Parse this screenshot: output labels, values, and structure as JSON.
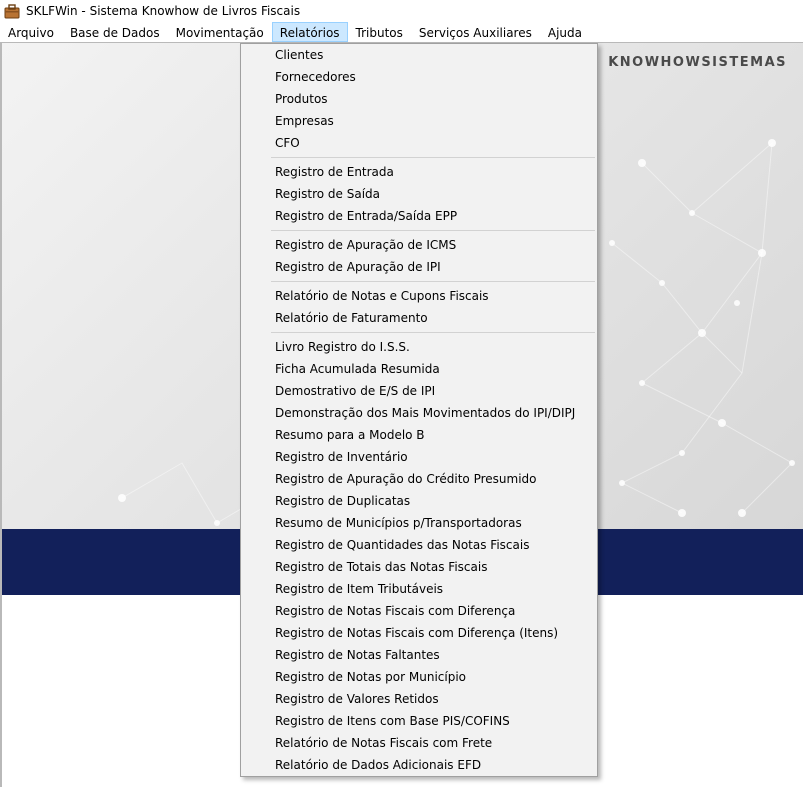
{
  "window": {
    "title": "SKLFWin - Sistema Knowhow de Livros Fiscais",
    "icon": "briefcase-icon"
  },
  "menubar": {
    "items": [
      "Arquivo",
      "Base de Dados",
      "Movimentação",
      "Relatórios",
      "Tributos",
      "Serviços Auxiliares",
      "Ajuda"
    ],
    "active": "Relatórios"
  },
  "banner": {
    "brand": "KNOWHOWSISTEMAS"
  },
  "colors": {
    "menu_highlight": "#cce8ff",
    "navy_band": "#12205a",
    "menu_background": "#f2f2f2"
  },
  "dropdown": {
    "groups": [
      [
        "Clientes",
        "Fornecedores",
        "Produtos",
        "Empresas",
        "CFO"
      ],
      [
        "Registro de Entrada",
        "Registro de Saída",
        "Registro de Entrada/Saída EPP"
      ],
      [
        "Registro de Apuração de ICMS",
        "Registro de Apuração de IPI"
      ],
      [
        "Relatório de Notas e Cupons Fiscais",
        "Relatório de Faturamento"
      ],
      [
        "Livro Registro do I.S.S.",
        "Ficha Acumulada Resumida",
        "Demostrativo de E/S de IPI",
        "Demonstração dos Mais Movimentados do IPI/DIPJ",
        "Resumo para a Modelo B",
        "Registro de Inventário",
        "Registro de Apuração do Crédito Presumido",
        "Registro de Duplicatas",
        "Resumo de Municípios p/Transportadoras",
        "Registro de Quantidades das Notas Fiscais",
        "Registro de Totais das Notas Fiscais",
        "Registro de Item Tributáveis",
        "Registro de Notas Fiscais com Diferença",
        "Registro de Notas Fiscais com Diferença (Itens)",
        "Registro de Notas Faltantes",
        "Registro de Notas por Município",
        "Registro de Valores Retidos",
        "Registro de Itens com Base PIS/COFINS",
        "Relatório de Notas Fiscais com Frete",
        "Relatório de Dados Adicionais EFD"
      ]
    ]
  }
}
